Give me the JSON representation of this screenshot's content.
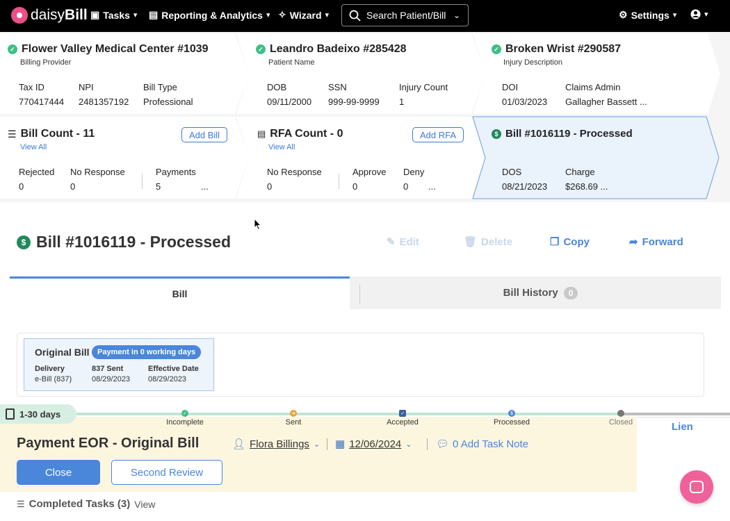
{
  "nav": {
    "logo_brand": "daisy",
    "logo_brand_bold": "Bill",
    "tasks": "Tasks",
    "reporting": "Reporting & Analytics",
    "wizard": "Wizard",
    "search_placeholder": "Search Patient/Bill",
    "settings": "Settings"
  },
  "provider_card": {
    "title": "Flower Valley Medical Center #1039",
    "subtitle": "Billing Provider",
    "fields": [
      {
        "label": "Tax ID",
        "value": "770417444"
      },
      {
        "label": "NPI",
        "value": "2481357192"
      },
      {
        "label": "Bill Type",
        "value": "Professional"
      }
    ]
  },
  "patient_card": {
    "title": "Leandro Badeixo #285428",
    "subtitle": "Patient Name",
    "fields": [
      {
        "label": "DOB",
        "value": "09/11/2000"
      },
      {
        "label": "SSN",
        "value": "999-99-9999"
      },
      {
        "label": "Injury Count",
        "value": "1"
      }
    ]
  },
  "injury_card": {
    "title": "Broken Wrist #290587",
    "subtitle": "Injury Description",
    "fields": [
      {
        "label": "DOI",
        "value": "01/03/2023"
      },
      {
        "label": "Claims Admin",
        "value": "Gallagher Bassett ..."
      }
    ]
  },
  "bill_count_card": {
    "title": "Bill Count - 11",
    "link": "View All",
    "button": "Add Bill",
    "fields": [
      {
        "label": "Rejected",
        "value": "0"
      },
      {
        "label": "No Response",
        "value": "0"
      },
      {
        "label": "Payments",
        "value": "5"
      }
    ],
    "more": "..."
  },
  "rfa_card": {
    "title": "RFA Count - 0",
    "link": "View All",
    "button": "Add RFA",
    "fields": [
      {
        "label": "No Response",
        "value": "0"
      },
      {
        "label": "Approve",
        "value": "0"
      },
      {
        "label": "Deny",
        "value": "0"
      }
    ],
    "more": "..."
  },
  "bill_card": {
    "title": "Bill #1016119 - Processed",
    "fields": [
      {
        "label": "DOS",
        "value": "08/21/2023"
      },
      {
        "label": "Charge",
        "value": "$268.69 ..."
      }
    ]
  },
  "bill_heading": {
    "title": "Bill #1016119 - Processed",
    "edit": "Edit",
    "delete": "Delete",
    "copy": "Copy",
    "forward": "Forward"
  },
  "tabs": {
    "bill": "Bill",
    "history": "Bill History",
    "history_count": "0"
  },
  "original_bill": {
    "title": "Original Bill",
    "pill": "Payment in 0 working days",
    "fields": [
      {
        "label": "Delivery",
        "value": "e-Bill (837)"
      },
      {
        "label": "837 Sent",
        "value": "08/29/2023"
      },
      {
        "label": "Effective Date",
        "value": "08/29/2023"
      }
    ]
  },
  "progress": {
    "badge": "1-30 days",
    "steps": [
      "Incomplete",
      "Sent",
      "Accepted",
      "Processed",
      "Closed"
    ]
  },
  "task": {
    "title": "Payment EOR - Original Bill",
    "assignee": "Flora Billings",
    "due_date": "12/06/2024",
    "note": "0 Add Task Note",
    "close": "Close",
    "second_review": "Second Review",
    "lien": "Lien"
  },
  "completed": {
    "label": "Completed Tasks (3)",
    "view": "View"
  },
  "colors": {
    "accent": "#4a86d9",
    "success": "#3fbf88",
    "panel_bg": "#fdf6df",
    "chat": "#f0619a"
  }
}
